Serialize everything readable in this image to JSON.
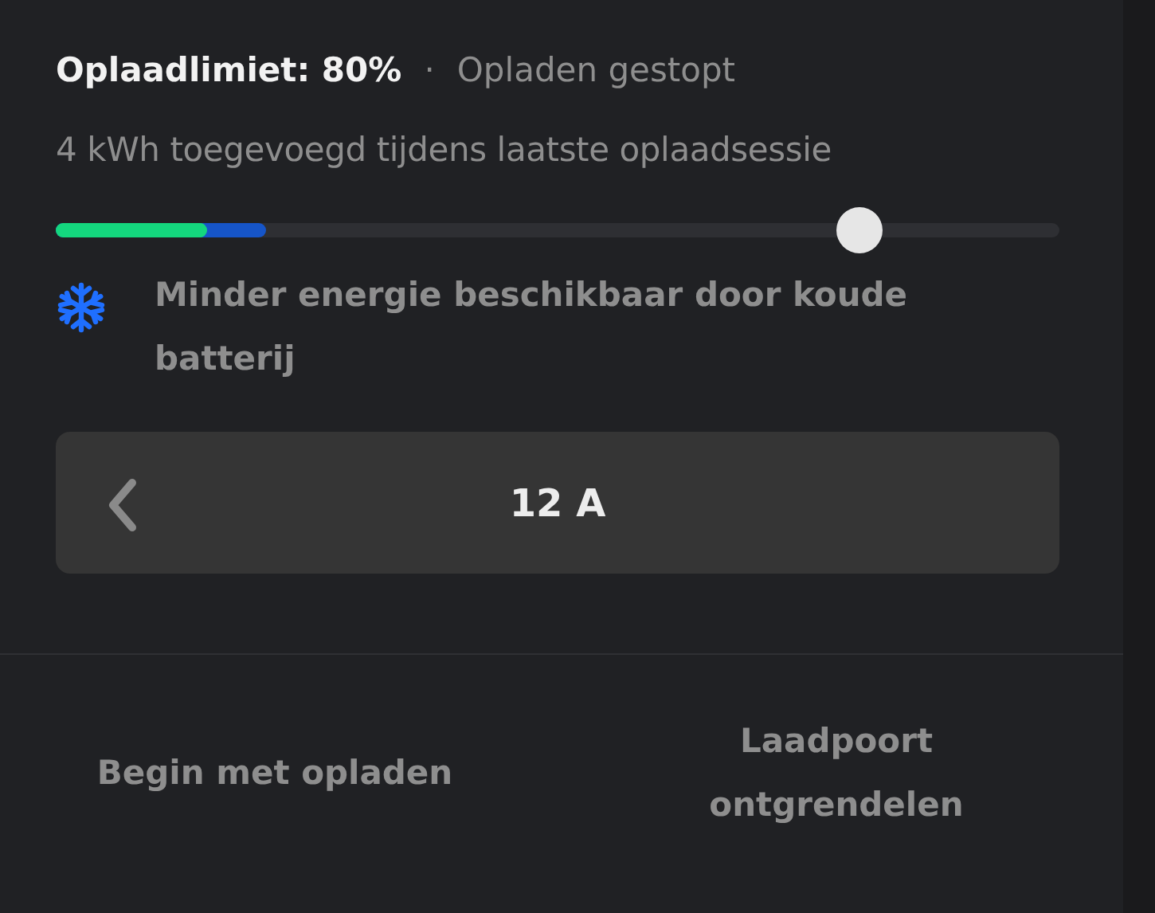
{
  "header": {
    "limit_label": "Oplaadlimiet: 80%",
    "separator": "·",
    "status": "Opladen gestopt"
  },
  "session_info": "4 kWh toegevoegd tijdens laatste oplaadsessie",
  "charge_slider": {
    "level": 0.8,
    "segments": [
      {
        "level": 0.15,
        "color": "#14d77e"
      },
      {
        "level": 0.21,
        "color": "#1655c8"
      }
    ]
  },
  "warning": {
    "text": "Minder energie beschikbaar door koude batterij"
  },
  "current_stepper": {
    "value": "12 A"
  },
  "actions": [
    {
      "label": "Begin met opladen"
    },
    {
      "label": "Laadpoort ontgrendelen"
    }
  ]
}
